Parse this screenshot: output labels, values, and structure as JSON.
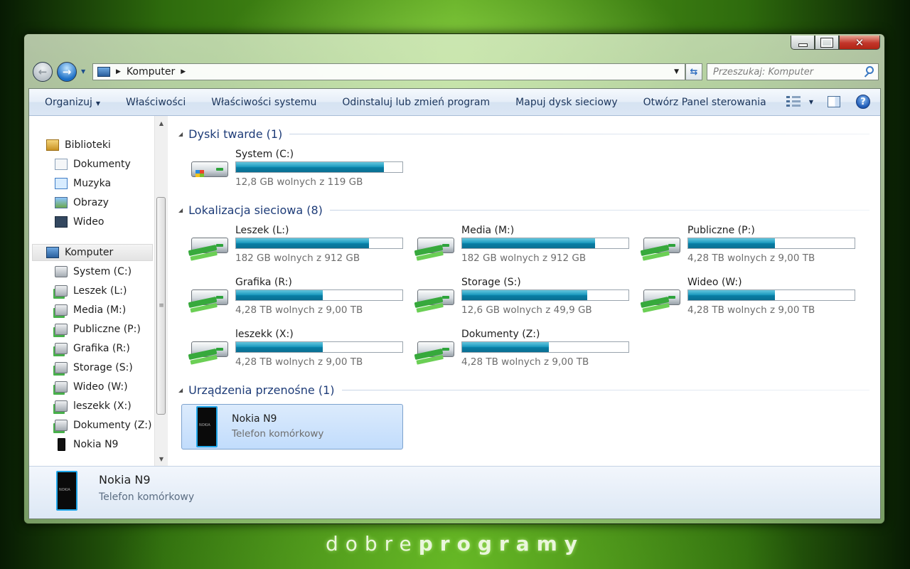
{
  "window": {
    "address_path": "Komputer",
    "search_placeholder": "Przeszukaj: Komputer"
  },
  "toolbar": {
    "organize": "Organizuj",
    "properties": "Właściwości",
    "system_properties": "Właściwości systemu",
    "uninstall": "Odinstaluj lub zmień program",
    "map_drive": "Mapuj dysk sieciowy",
    "control_panel": "Otwórz Panel sterowania",
    "help_glyph": "?"
  },
  "nav_pane": {
    "libraries": "Biblioteki",
    "library_items": [
      "Dokumenty",
      "Muzyka",
      "Obrazy",
      "Wideo"
    ],
    "computer": "Komputer",
    "drives": [
      "System (C:)",
      "Leszek (L:)",
      "Media (M:)",
      "Publiczne (P:)",
      "Grafika (R:)",
      "Storage (S:)",
      "Wideo (W:)",
      "leszekk (X:)",
      "Dokumenty (Z:)",
      "Nokia N9"
    ]
  },
  "groups": {
    "hard_drives": "Dyski twarde (1)",
    "network": "Lokalizacja sieciowa (8)",
    "removable": "Urządzenia przenośne (1)"
  },
  "hard_drives": [
    {
      "name": "System (C:)",
      "free": "12,8 GB wolnych z 119 GB",
      "used_fraction": 0.89
    }
  ],
  "network_drives": [
    {
      "name": "Leszek (L:)",
      "free": "182 GB wolnych z 912 GB",
      "used_fraction": 0.8
    },
    {
      "name": "Media (M:)",
      "free": "182 GB wolnych z 912 GB",
      "used_fraction": 0.8
    },
    {
      "name": "Publiczne (P:)",
      "free": "4,28 TB wolnych z 9,00 TB",
      "used_fraction": 0.52
    },
    {
      "name": "Grafika (R:)",
      "free": "4,28 TB wolnych z 9,00 TB",
      "used_fraction": 0.52
    },
    {
      "name": "Storage (S:)",
      "free": "12,6 GB wolnych z 49,9 GB",
      "used_fraction": 0.75
    },
    {
      "name": "Wideo (W:)",
      "free": "4,28 TB wolnych z 9,00 TB",
      "used_fraction": 0.52
    },
    {
      "name": "leszekk (X:)",
      "free": "4,28 TB wolnych z 9,00 TB",
      "used_fraction": 0.52
    },
    {
      "name": "Dokumenty (Z:)",
      "free": "4,28 TB wolnych z 9,00 TB",
      "used_fraction": 0.52
    }
  ],
  "device": {
    "name": "Nokia N9",
    "type": "Telefon komórkowy"
  },
  "details": {
    "name": "Nokia N9",
    "type": "Telefon komórkowy"
  },
  "watermark": {
    "part1": "dobre",
    "part2": "programy"
  },
  "colors": {
    "bar_fill": "#0b7fa5",
    "group_title": "#1e3c78",
    "selection": "#c1dcfc"
  }
}
